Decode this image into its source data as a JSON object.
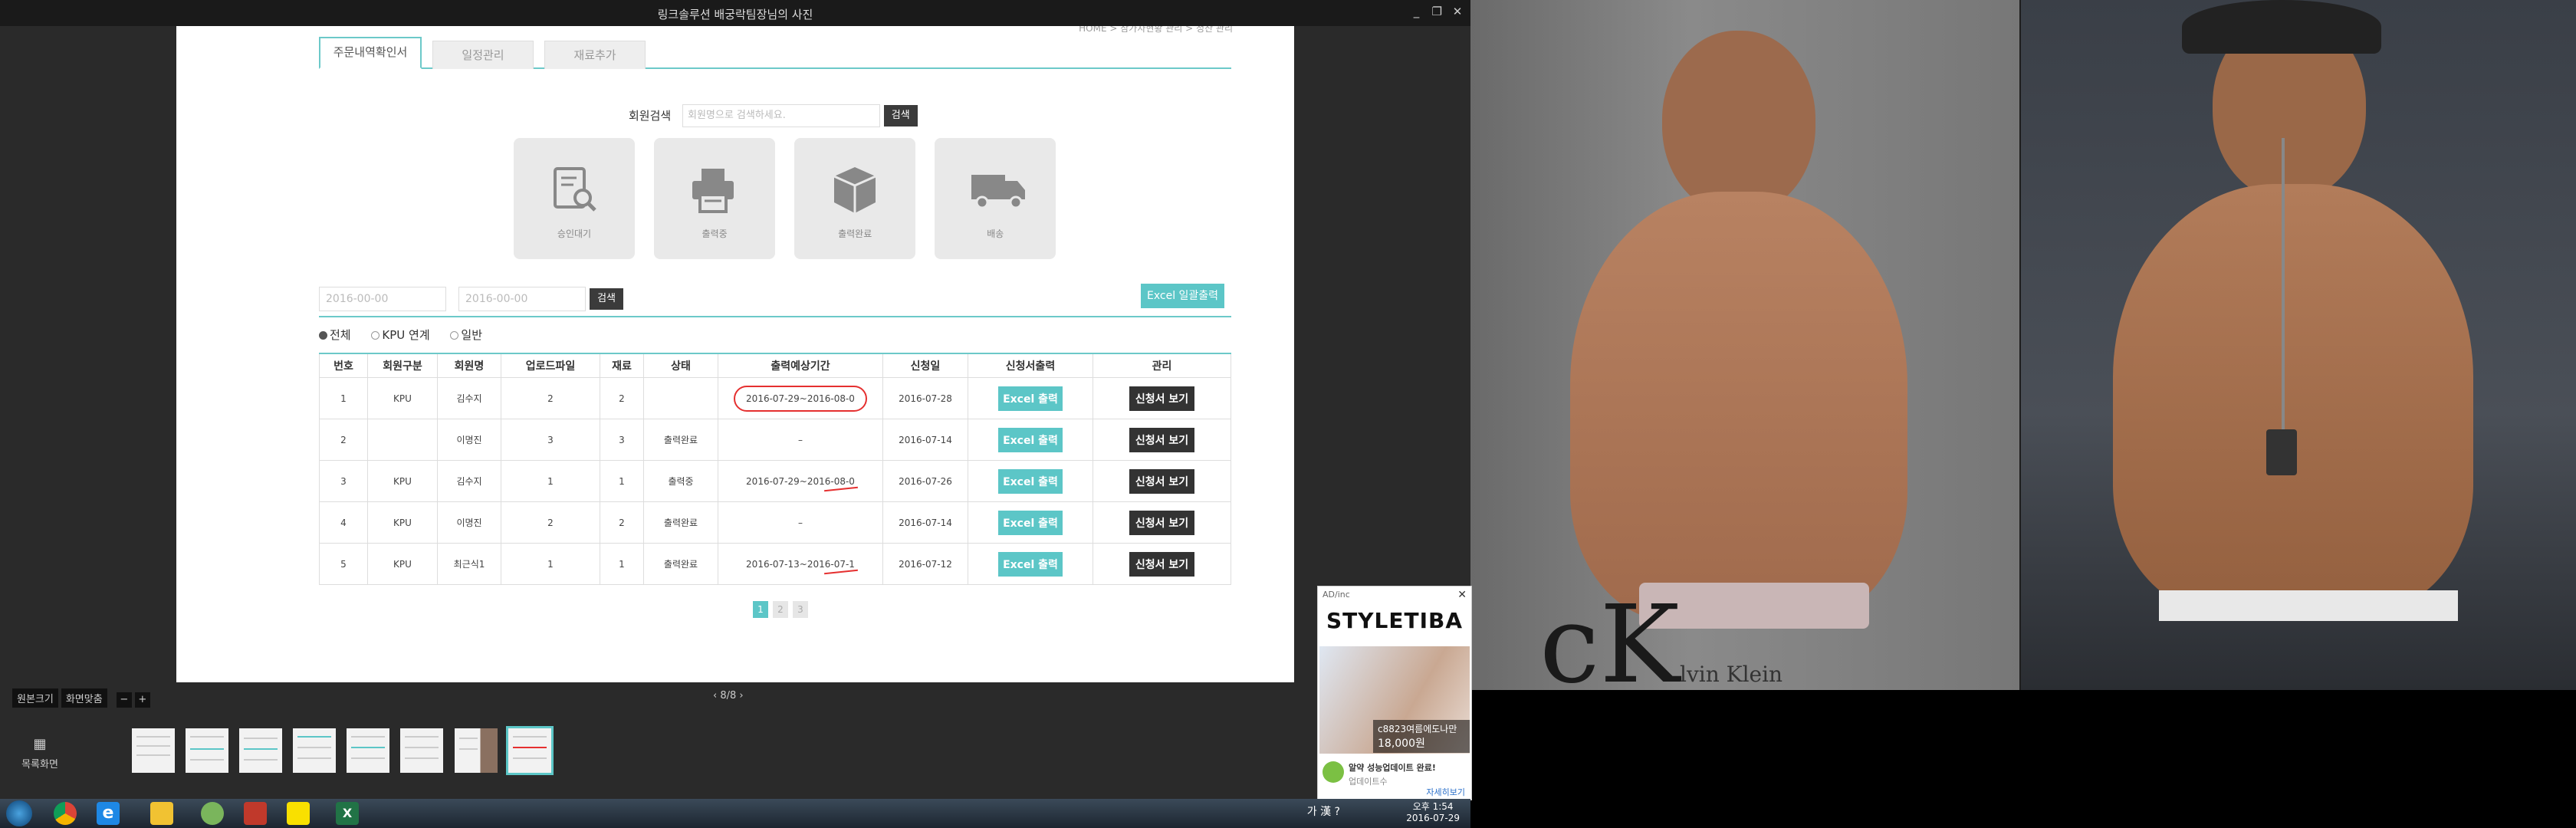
{
  "window": {
    "title": "링크솔루션 배궁락팀장님의 사진",
    "controls": [
      "_",
      "❐",
      "✕"
    ]
  },
  "breadcrumb": "HOME > 참가자현황 관리 > 정산 관리",
  "tabs": [
    "주문내역확인서",
    "일정관리",
    "재료추가"
  ],
  "member_search": {
    "label": "회원검색",
    "placeholder": "회원명으로 검색하세요.",
    "button": "검색"
  },
  "status_cards": [
    "승인대기",
    "출력중",
    "출력완료",
    "배송"
  ],
  "date_filter": {
    "from": "2016-00-00",
    "to": "2016-00-00",
    "button": "검색"
  },
  "excel_all": "Excel 일괄출력",
  "filters": [
    "전체",
    "KPU 연계",
    "일반"
  ],
  "table": {
    "headers": [
      "번호",
      "회원구분",
      "회원명",
      "업로드파일",
      "재료",
      "상태",
      "출력예상기간",
      "신청일",
      "신청서출력",
      "관리"
    ],
    "rows": [
      {
        "no": "1",
        "type": "KPU",
        "name": "김수지",
        "files": "2",
        "material": "2",
        "status": "",
        "period": "2016-07-29~2016-08-0",
        "date": "2016-07-28",
        "excel": "Excel 출력",
        "view": "신청서 보기"
      },
      {
        "no": "2",
        "type": "",
        "name": "이명진",
        "files": "3",
        "material": "3",
        "status": "출력완료",
        "period": "–",
        "date": "2016-07-14",
        "excel": "Excel 출력",
        "view": "신청서 보기"
      },
      {
        "no": "3",
        "type": "KPU",
        "name": "김수지",
        "files": "1",
        "material": "1",
        "status": "출력중",
        "period": "2016-07-29~2016-08-0",
        "date": "2016-07-26",
        "excel": "Excel 출력",
        "view": "신청서 보기"
      },
      {
        "no": "4",
        "type": "KPU",
        "name": "이명진",
        "files": "2",
        "material": "2",
        "status": "출력완료",
        "period": "–",
        "date": "2016-07-14",
        "excel": "Excel 출력",
        "view": "신청서 보기"
      },
      {
        "no": "5",
        "type": "KPU",
        "name": "최근식1",
        "files": "1",
        "material": "1",
        "status": "출력완료",
        "period": "2016-07-13~2016-07-1",
        "date": "2016-07-12",
        "excel": "Excel 출력",
        "view": "신청서 보기"
      }
    ]
  },
  "pagination": [
    "1",
    "2",
    "3"
  ],
  "viewer": {
    "zoom_original": "원본크기",
    "zoom_fit": "화면맞춤",
    "page_indicator": "8/8",
    "list_view": "목록화면"
  },
  "photo": {
    "brand_text": "cK",
    "brand_sub": "lvin Klein"
  },
  "ad": {
    "label": "AD/inc",
    "brand": "STYLETIBA",
    "product": "c8823여름에도나만",
    "price": "18,000원",
    "bottom_text": "알약 성능업데이트 완료!",
    "bottom_sub": "업데이트수",
    "bottom_link": "자세히보기"
  },
  "taskbar": {
    "ime": "가 漢 ?",
    "time": "오후 1:54",
    "date": "2016-07-29"
  },
  "colors": {
    "accent": "#5cc6c7",
    "dark_button": "#333333",
    "highlight_red": "#e53030"
  }
}
